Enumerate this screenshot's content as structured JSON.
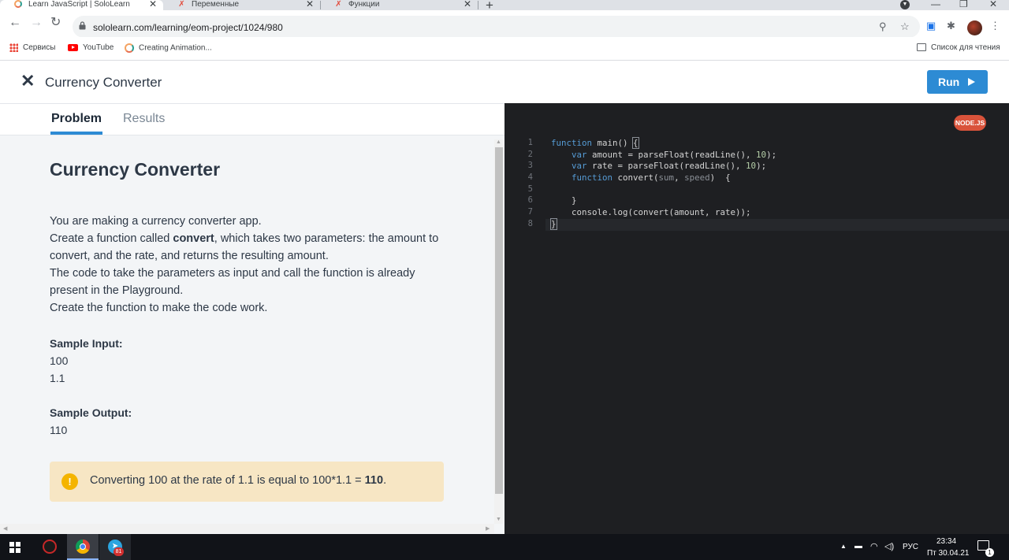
{
  "browser": {
    "tabs": [
      {
        "title": "Learn JavaScript | SoloLearn",
        "active": true,
        "icon": "sololearn-ring-icon"
      },
      {
        "title": "Переменные",
        "active": false,
        "icon": "sololearn-figure-icon"
      },
      {
        "title": "Функции",
        "active": false,
        "icon": "sololearn-figure-icon"
      }
    ],
    "url": "sololearn.com/learning/eom-project/1024/980",
    "bookmarks": [
      {
        "label": "Сервисы",
        "icon": "apps-grid-icon"
      },
      {
        "label": "YouTube",
        "icon": "youtube-icon"
      },
      {
        "label": "Creating Animation...",
        "icon": "ring-icon"
      }
    ],
    "reading_list": "Список для чтения"
  },
  "app": {
    "title": "Currency Converter",
    "run_label": "Run",
    "tabs": {
      "problem": "Problem",
      "results": "Results"
    },
    "accent": "#2d8bd4"
  },
  "problem": {
    "title": "Currency Converter",
    "desc_line1": "You are making a currency converter app.",
    "desc_line2_pre": "Create a function called ",
    "desc_line2_bold": "convert",
    "desc_line2_post": ", which takes two parameters: the amount to convert, and the rate, and returns the resulting amount.",
    "desc_line3": "The code to take the parameters as input and call the function is already present in the Playground.",
    "desc_line4": "Create the function to make the code work.",
    "sample_input_label": "Sample Input:",
    "sample_input": [
      "100",
      "1.1"
    ],
    "sample_output_label": "Sample Output:",
    "sample_output": "110",
    "hint_pre": "Converting 100 at the rate of 1.1 is equal to 100*1.1 = ",
    "hint_bold": "110",
    "hint_post": "."
  },
  "editor": {
    "badge": "NODE.JS",
    "line_numbers": [
      "1",
      "2",
      "3",
      "4",
      "5",
      "6",
      "7",
      "8"
    ],
    "code": {
      "l1_kw": "function",
      "l1_rest": " main() ",
      "l1_brace": "{",
      "l2_kw": "var",
      "l2_a": " amount = parseFloat(readLine(), ",
      "l2_num": "10",
      "l2_b": ");",
      "l3_kw": "var",
      "l3_a": " rate = parseFloat(readLine(), ",
      "l3_num": "10",
      "l3_b": ");",
      "l4_kw": "function",
      "l4_a": " convert(",
      "l4_p1": "sum",
      "l4_c": ", ",
      "l4_p2": "speed",
      "l4_b": ")  {",
      "l6": "}",
      "l7": "console.log(convert(amount, rate));",
      "l8": "}"
    }
  },
  "taskbar": {
    "lang": "РУС",
    "time": "23:34",
    "date": "Пт 30.04.21",
    "telegram_badge": "81",
    "notification_count": "1"
  }
}
